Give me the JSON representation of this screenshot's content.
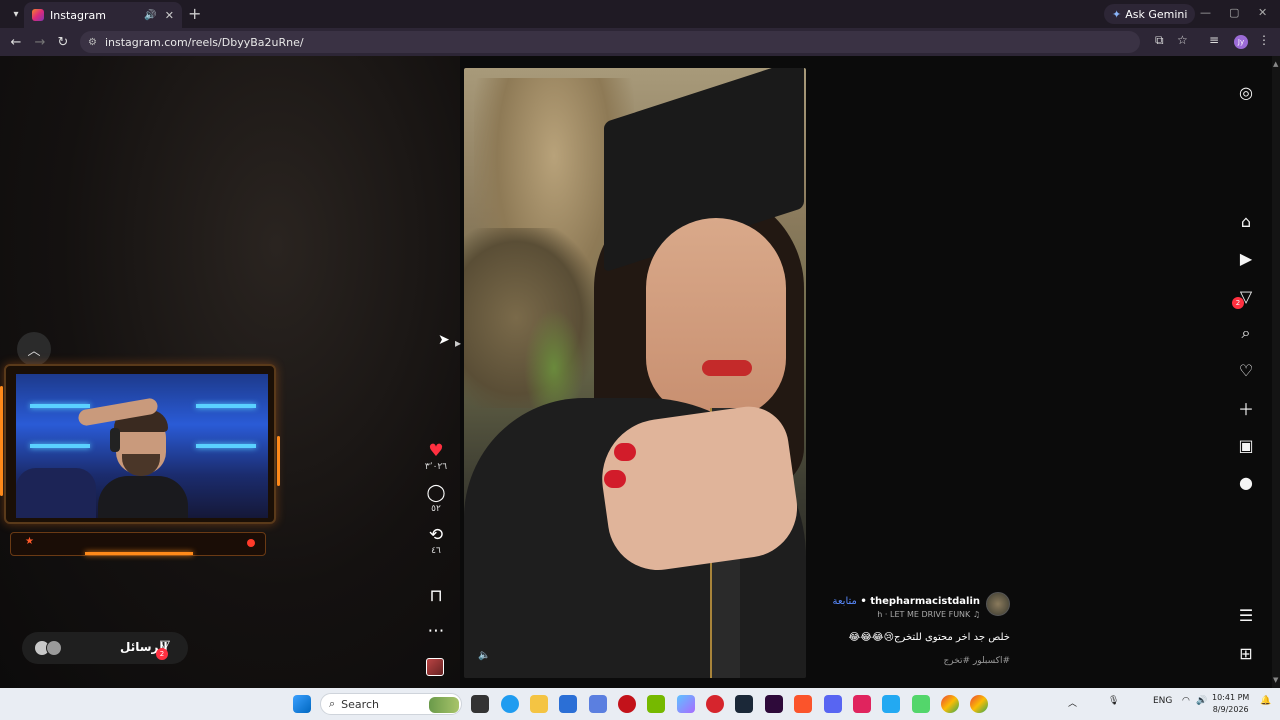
{
  "browser": {
    "tab_title": "Instagram",
    "url": "instagram.com/reels/DbyyBa2uRne/",
    "ask_gemini": "Ask Gemini",
    "profile_initials": "Jy"
  },
  "reel": {
    "likes": "٣٬٠٢٦",
    "comments": "٥٢",
    "reposts": "٤٦",
    "username": "thepharmacistdalin",
    "follow_label": "متابعة",
    "audio": "h · LET ME DRIVE FUNK",
    "caption": "خلص جد اخر محتوى للتخرج😢😂😂😂",
    "tags": "#اكسبلور #تخرج"
  },
  "messages": {
    "label": "الرسائل",
    "badge": "2"
  },
  "nav": {
    "messages_badge": "2"
  },
  "taskbar": {
    "search_placeholder": "Search",
    "lang": "ENG",
    "time": "10:41 PM",
    "date": "8/9/2026"
  },
  "colors": {
    "like": "#ff3040",
    "follow": "#5a8bff",
    "stream_accent": "#ff8a1a"
  }
}
